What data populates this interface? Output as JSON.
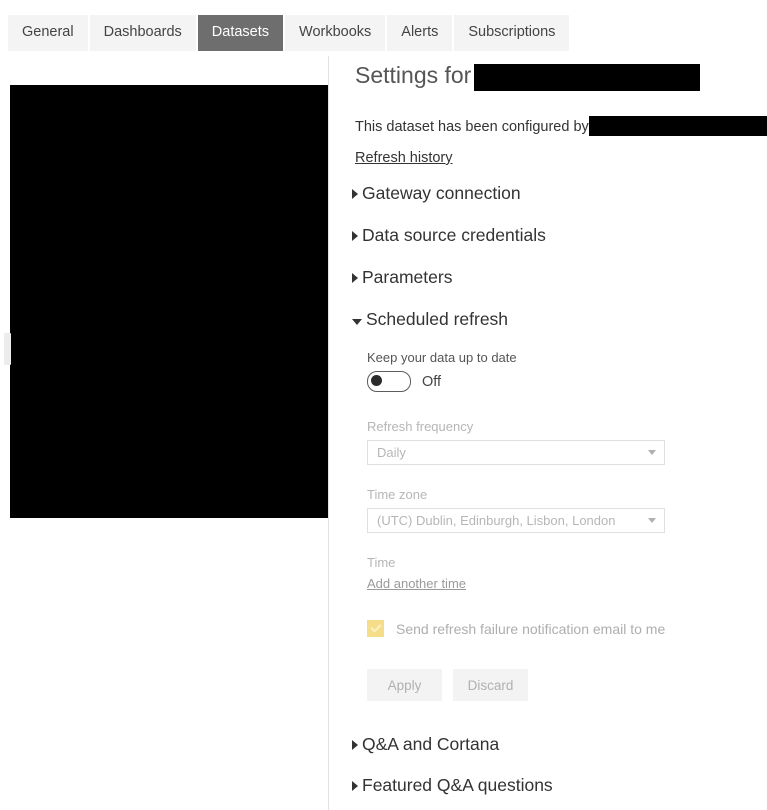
{
  "tabs": [
    {
      "label": "General",
      "active": false
    },
    {
      "label": "Dashboards",
      "active": false
    },
    {
      "label": "Datasets",
      "active": true
    },
    {
      "label": "Workbooks",
      "active": false
    },
    {
      "label": "Alerts",
      "active": false
    },
    {
      "label": "Subscriptions",
      "active": false
    }
  ],
  "header": {
    "title_prefix": "Settings for",
    "title_redacted": true,
    "configured_by_text": "This dataset has been configured by",
    "configured_by_redacted": true,
    "refresh_history_link": "Refresh history"
  },
  "sections": [
    {
      "id": "gateway",
      "label": "Gateway connection",
      "expanded": false
    },
    {
      "id": "creds",
      "label": "Data source credentials",
      "expanded": false
    },
    {
      "id": "params",
      "label": "Parameters",
      "expanded": false
    },
    {
      "id": "schedule",
      "label": "Scheduled refresh",
      "expanded": true
    },
    {
      "id": "qna",
      "label": "Q&A and Cortana",
      "expanded": false
    },
    {
      "id": "featured",
      "label": "Featured Q&A questions",
      "expanded": false
    }
  ],
  "scheduled_refresh": {
    "toggle_label": "Keep your data up to date",
    "toggle_state": "Off",
    "toggle_on": false,
    "frequency_label": "Refresh frequency",
    "frequency_value": "Daily",
    "frequency_disabled": true,
    "timezone_label": "Time zone",
    "timezone_value": "(UTC) Dublin, Edinburgh, Lisbon, London",
    "timezone_disabled": true,
    "time_label": "Time",
    "add_time_link": "Add another time",
    "notify_label": "Send refresh failure notification email to me",
    "notify_checked": true,
    "apply_label": "Apply",
    "discard_label": "Discard",
    "buttons_disabled": true
  },
  "colors": {
    "active_tab_bg": "#6e6e6e",
    "tab_bg": "#f4f4f4",
    "checkbox_yellow": "#f5dd8a",
    "disabled_text": "#b6b6b6",
    "body_text": "#333333",
    "redaction": "#000000"
  }
}
